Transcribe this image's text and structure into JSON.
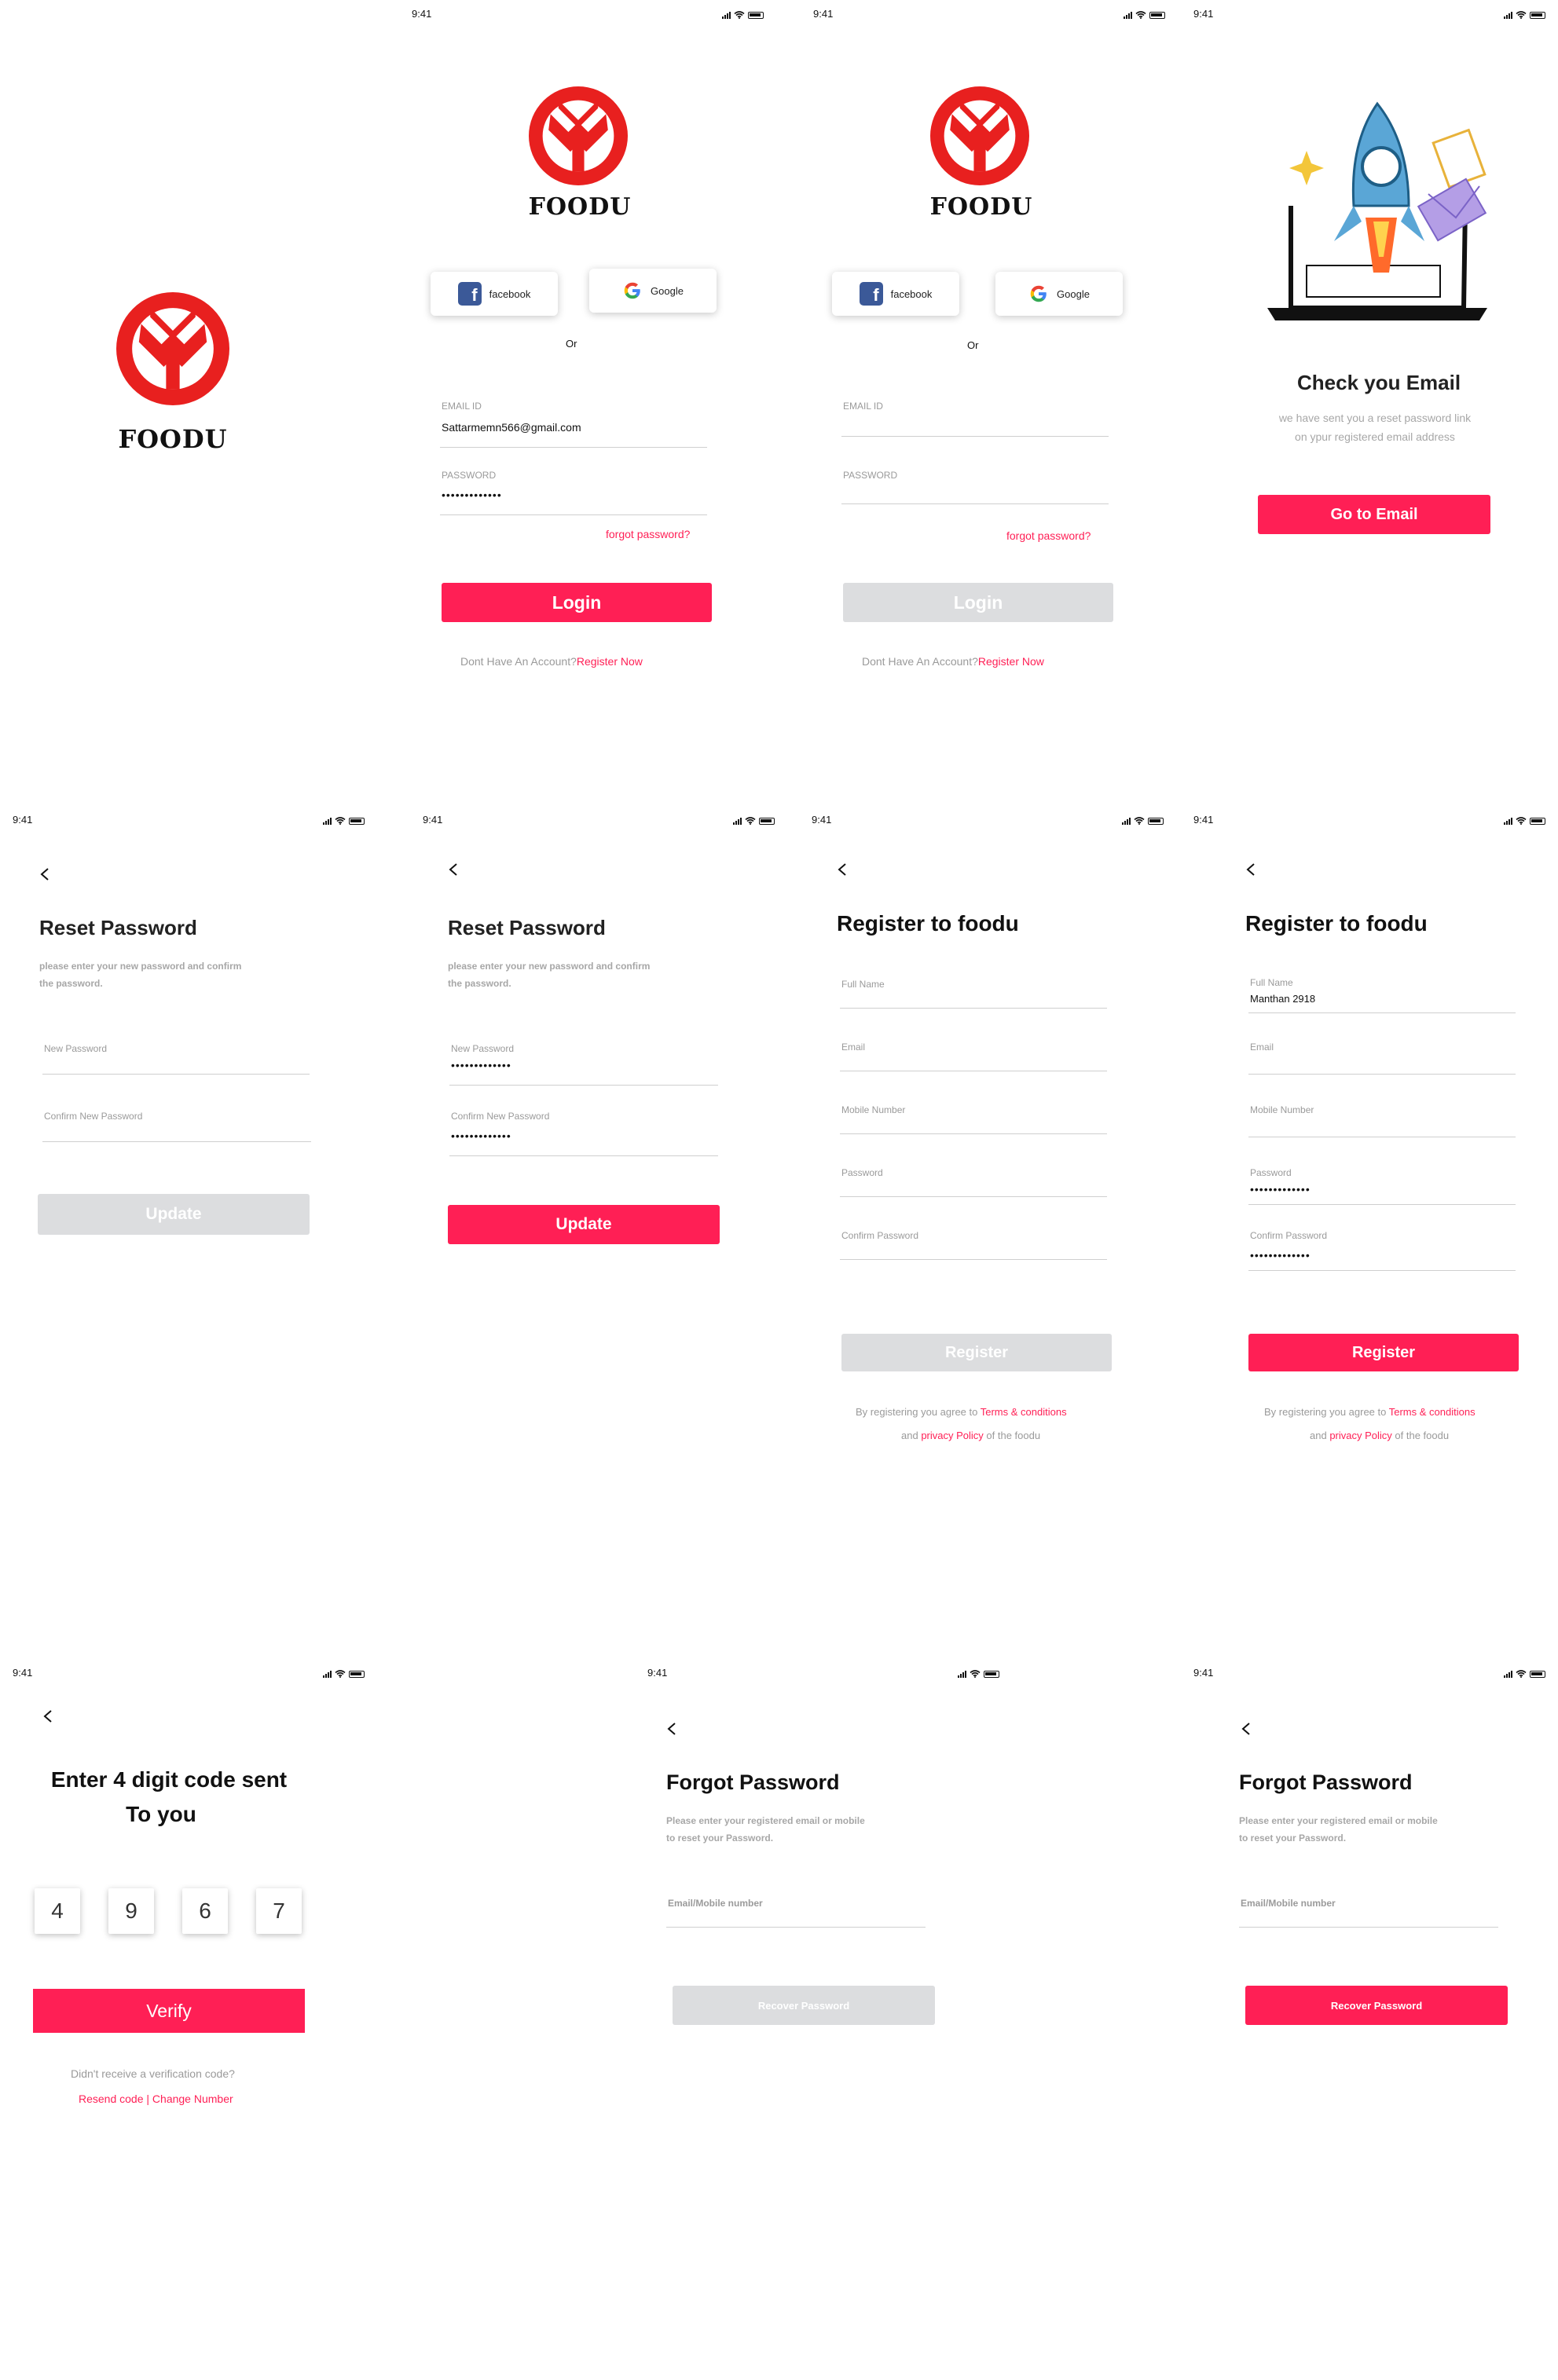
{
  "status_time": "9:41",
  "brand": "FOODU",
  "colors": {
    "accent": "#ff1f55",
    "disabled": "#dcdddf",
    "logo": "#e8201f"
  },
  "login": {
    "facebook_label": "facebook",
    "google_label": "Google",
    "or_label": "Or",
    "email_label": "EMAIL ID",
    "email_value": "Sattarmemn566@gmail.com",
    "password_label": "PASSWORD",
    "password_value": "•••••••••••••",
    "forgot_label": "forgot password?",
    "login_label": "Login",
    "no_account": "Dont Have An Account?",
    "register_now": "Register Now"
  },
  "check_email": {
    "title": "Check you Email",
    "line1": "we have sent you a reset password link",
    "line2": "on ypur registered email address",
    "button": "Go to Email"
  },
  "reset": {
    "title": "Reset Password",
    "desc1": "please enter your new password and confirm",
    "desc2": "the password.",
    "new_label": "New Password",
    "confirm_label": "Confirm  New Password",
    "password_value": "•••••••••••••",
    "button": "Update"
  },
  "register": {
    "title": "Register to foodu",
    "full_name_label": "Full Name",
    "full_name_value": "Manthan 2918",
    "email_label": "Email",
    "mobile_label": "Mobile Number",
    "password_label": "Password",
    "confirm_label": "Confirm Password",
    "password_value": "•••••••••••••",
    "button": "Register",
    "terms_prefix": "By registering you agree to ",
    "terms_link": "Terms & conditions",
    "and_text": "and ",
    "privacy_link": "privacy Policy",
    "terms_suffix": " of the foodu"
  },
  "verify": {
    "title_line1": "Enter 4 digit code sent",
    "title_line2": "To you",
    "digits": [
      "4",
      "9",
      "6",
      "7"
    ],
    "button": "Verify",
    "not_received": "Didn't receive a verification code?",
    "resend": "Resend code | Change Number"
  },
  "forgot": {
    "title": "Forgot Password",
    "desc1": "Please enter your registered email or mobile",
    "desc2": "to reset your Password.",
    "field_label": "Email/Mobile number",
    "button": "Recover Password"
  }
}
